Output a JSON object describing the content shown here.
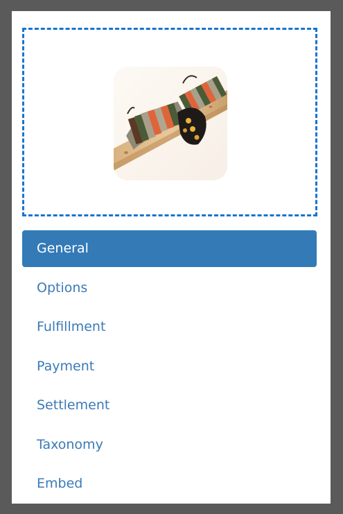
{
  "image": {
    "icon": "product-image-bracelet"
  },
  "colors": {
    "accent": "#337ab7",
    "link": "#3a7ab6",
    "dropzone_border": "#1874cd",
    "page_background": "#5a5a5a"
  },
  "nav": {
    "items": [
      {
        "label": "General",
        "active": true
      },
      {
        "label": "Options",
        "active": false
      },
      {
        "label": "Fulfillment",
        "active": false
      },
      {
        "label": "Payment",
        "active": false
      },
      {
        "label": "Settlement",
        "active": false
      },
      {
        "label": "Taxonomy",
        "active": false
      },
      {
        "label": "Embed",
        "active": false
      }
    ]
  }
}
